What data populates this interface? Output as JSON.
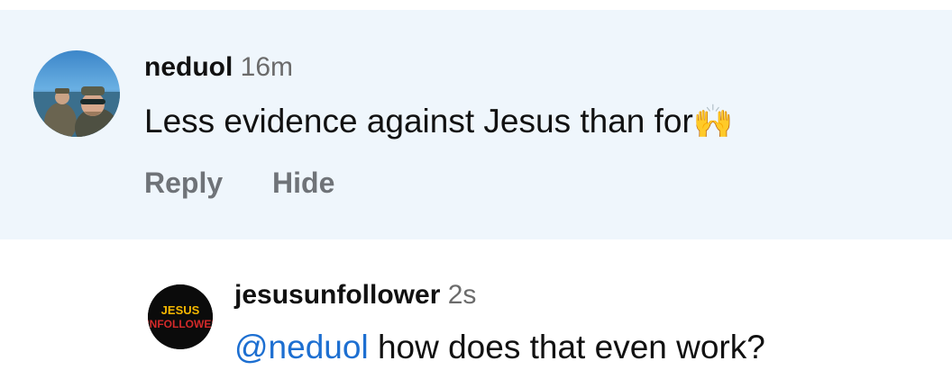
{
  "comment_main": {
    "username": "neduol",
    "time": "16m",
    "text": "Less evidence against Jesus than for",
    "emoji": "🙌",
    "actions": {
      "reply": "Reply",
      "hide": "Hide"
    }
  },
  "reply": {
    "username": "jesusunfollower",
    "time": "2s",
    "mention": "@neduol",
    "text": " how does that even work?",
    "avatar_logo_lines": [
      "JESUS",
      "UNFOLLOWER"
    ]
  },
  "colors": {
    "highlight_bg": "#eff6fc",
    "mention": "#1d6fd1",
    "muted": "#6b6b6b",
    "logo_red": "#d42a2a",
    "logo_yellow": "#f5b800"
  }
}
